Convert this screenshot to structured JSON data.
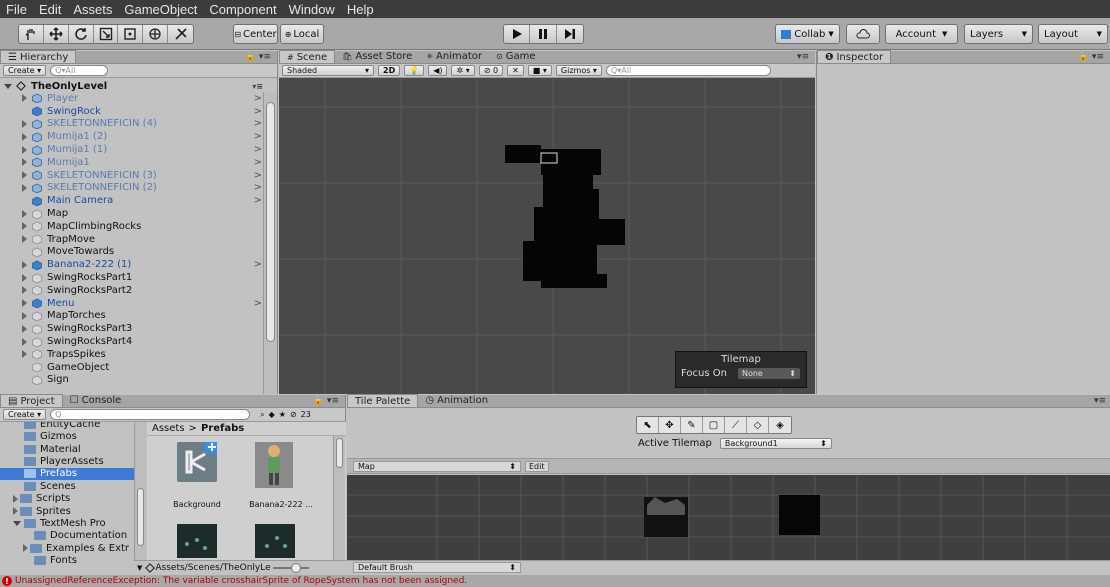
{
  "menu": [
    "File",
    "Edit",
    "Assets",
    "GameObject",
    "Component",
    "Window",
    "Help"
  ],
  "toolbar": {
    "center": "Center",
    "local": "Local",
    "collab": "Collab",
    "account": "Account",
    "layers": "Layers",
    "layout": "Layout"
  },
  "hierarchy": {
    "tab": "Hierarchy",
    "create": "Create",
    "search_placeholder": "Q▾All",
    "scene_name": "TheOnlyLevel",
    "items": [
      {
        "label": "Player",
        "prefab": true,
        "dim": true,
        "expand": true,
        "chev": true
      },
      {
        "label": "SwingRock",
        "prefab": true,
        "dim": false,
        "expand": false,
        "chev": true
      },
      {
        "label": "SKELETONNEFICIN (4)",
        "prefab": true,
        "dim": true,
        "expand": true,
        "chev": true
      },
      {
        "label": "Mumija1 (2)",
        "prefab": true,
        "dim": true,
        "expand": true,
        "chev": true
      },
      {
        "label": "Mumija1 (1)",
        "prefab": true,
        "dim": true,
        "expand": true,
        "chev": true
      },
      {
        "label": "Mumija1",
        "prefab": true,
        "dim": true,
        "expand": true,
        "chev": true
      },
      {
        "label": "SKELETONNEFICIN (3)",
        "prefab": true,
        "dim": true,
        "expand": true,
        "chev": true
      },
      {
        "label": "SKELETONNEFICIN (2)",
        "prefab": true,
        "dim": true,
        "expand": true,
        "chev": true
      },
      {
        "label": "Main Camera",
        "prefab": true,
        "dim": false,
        "expand": false,
        "chev": true
      },
      {
        "label": "Map",
        "prefab": false,
        "dim": false,
        "expand": true,
        "chev": false
      },
      {
        "label": "MapClimbingRocks",
        "prefab": false,
        "dim": false,
        "expand": true,
        "chev": false
      },
      {
        "label": "TrapMove",
        "prefab": false,
        "dim": false,
        "expand": true,
        "chev": false
      },
      {
        "label": "MoveTowards",
        "prefab": false,
        "dim": false,
        "expand": false,
        "chev": false
      },
      {
        "label": "Banana2-222 (1)",
        "prefab": true,
        "dim": false,
        "expand": true,
        "chev": true
      },
      {
        "label": "SwingRocksPart1",
        "prefab": false,
        "dim": false,
        "expand": true,
        "chev": false
      },
      {
        "label": "SwingRocksPart2",
        "prefab": false,
        "dim": false,
        "expand": true,
        "chev": false
      },
      {
        "label": "Menu",
        "prefab": true,
        "dim": false,
        "expand": true,
        "chev": true
      },
      {
        "label": "MapTorches",
        "prefab": false,
        "dim": false,
        "expand": true,
        "chev": false
      },
      {
        "label": "SwingRocksPart3",
        "prefab": false,
        "dim": false,
        "expand": true,
        "chev": false
      },
      {
        "label": "SwingRocksPart4",
        "prefab": false,
        "dim": false,
        "expand": true,
        "chev": false
      },
      {
        "label": "TrapsSpikes",
        "prefab": false,
        "dim": false,
        "expand": true,
        "chev": false
      },
      {
        "label": "GameObject",
        "prefab": false,
        "dim": false,
        "expand": false,
        "chev": false
      },
      {
        "label": "Sign",
        "prefab": false,
        "dim": false,
        "expand": false,
        "chev": false
      }
    ]
  },
  "scene": {
    "tabs": [
      "Scene",
      "Asset Store",
      "Animator",
      "Game"
    ],
    "shaded": "Shaded",
    "mode2d": "2D",
    "fx_count": "0",
    "gizmos": "Gizmos",
    "search_placeholder": "Q▾All"
  },
  "inspector": {
    "tab": "Inspector"
  },
  "tilemap_overlay": {
    "title": "Tilemap",
    "focus_label": "Focus On",
    "focus_value": "None"
  },
  "project": {
    "tabs": [
      "Project",
      "Console"
    ],
    "create": "Create",
    "badge": "23",
    "folders": [
      {
        "label": "EntityCache",
        "indent": 1,
        "expand": false
      },
      {
        "label": "Gizmos",
        "indent": 1,
        "expand": false
      },
      {
        "label": "Material",
        "indent": 1,
        "expand": false
      },
      {
        "label": "PlayerAssets",
        "indent": 1,
        "expand": false
      },
      {
        "label": "Prefabs",
        "indent": 1,
        "expand": false,
        "selected": true
      },
      {
        "label": "Scenes",
        "indent": 1,
        "expand": false
      },
      {
        "label": "Scripts",
        "indent": 1,
        "expand": true
      },
      {
        "label": "Sprites",
        "indent": 1,
        "expand": true
      },
      {
        "label": "TextMesh Pro",
        "indent": 1,
        "expand": true,
        "open": true
      },
      {
        "label": "Documentation",
        "indent": 2,
        "expand": false
      },
      {
        "label": "Examples & Extr",
        "indent": 2,
        "expand": true
      },
      {
        "label": "Fonts",
        "indent": 2,
        "expand": false
      }
    ],
    "breadcrumb": [
      "Assets",
      "Prefabs"
    ],
    "assets": [
      "Background",
      "Banana2-222 ..."
    ],
    "footer_path": "Assets/Scenes/TheOnlyLe"
  },
  "palette": {
    "tabs": [
      "Tile Palette",
      "Animation"
    ],
    "active_tilemap_label": "Active Tilemap",
    "active_tilemap_value": "Background1",
    "map_label": "Map",
    "edit_label": "Edit",
    "brush": "Default Brush"
  },
  "status": {
    "message": "UnassignedReferenceException: The variable crosshairSprite of RopeSystem has not been assigned."
  }
}
